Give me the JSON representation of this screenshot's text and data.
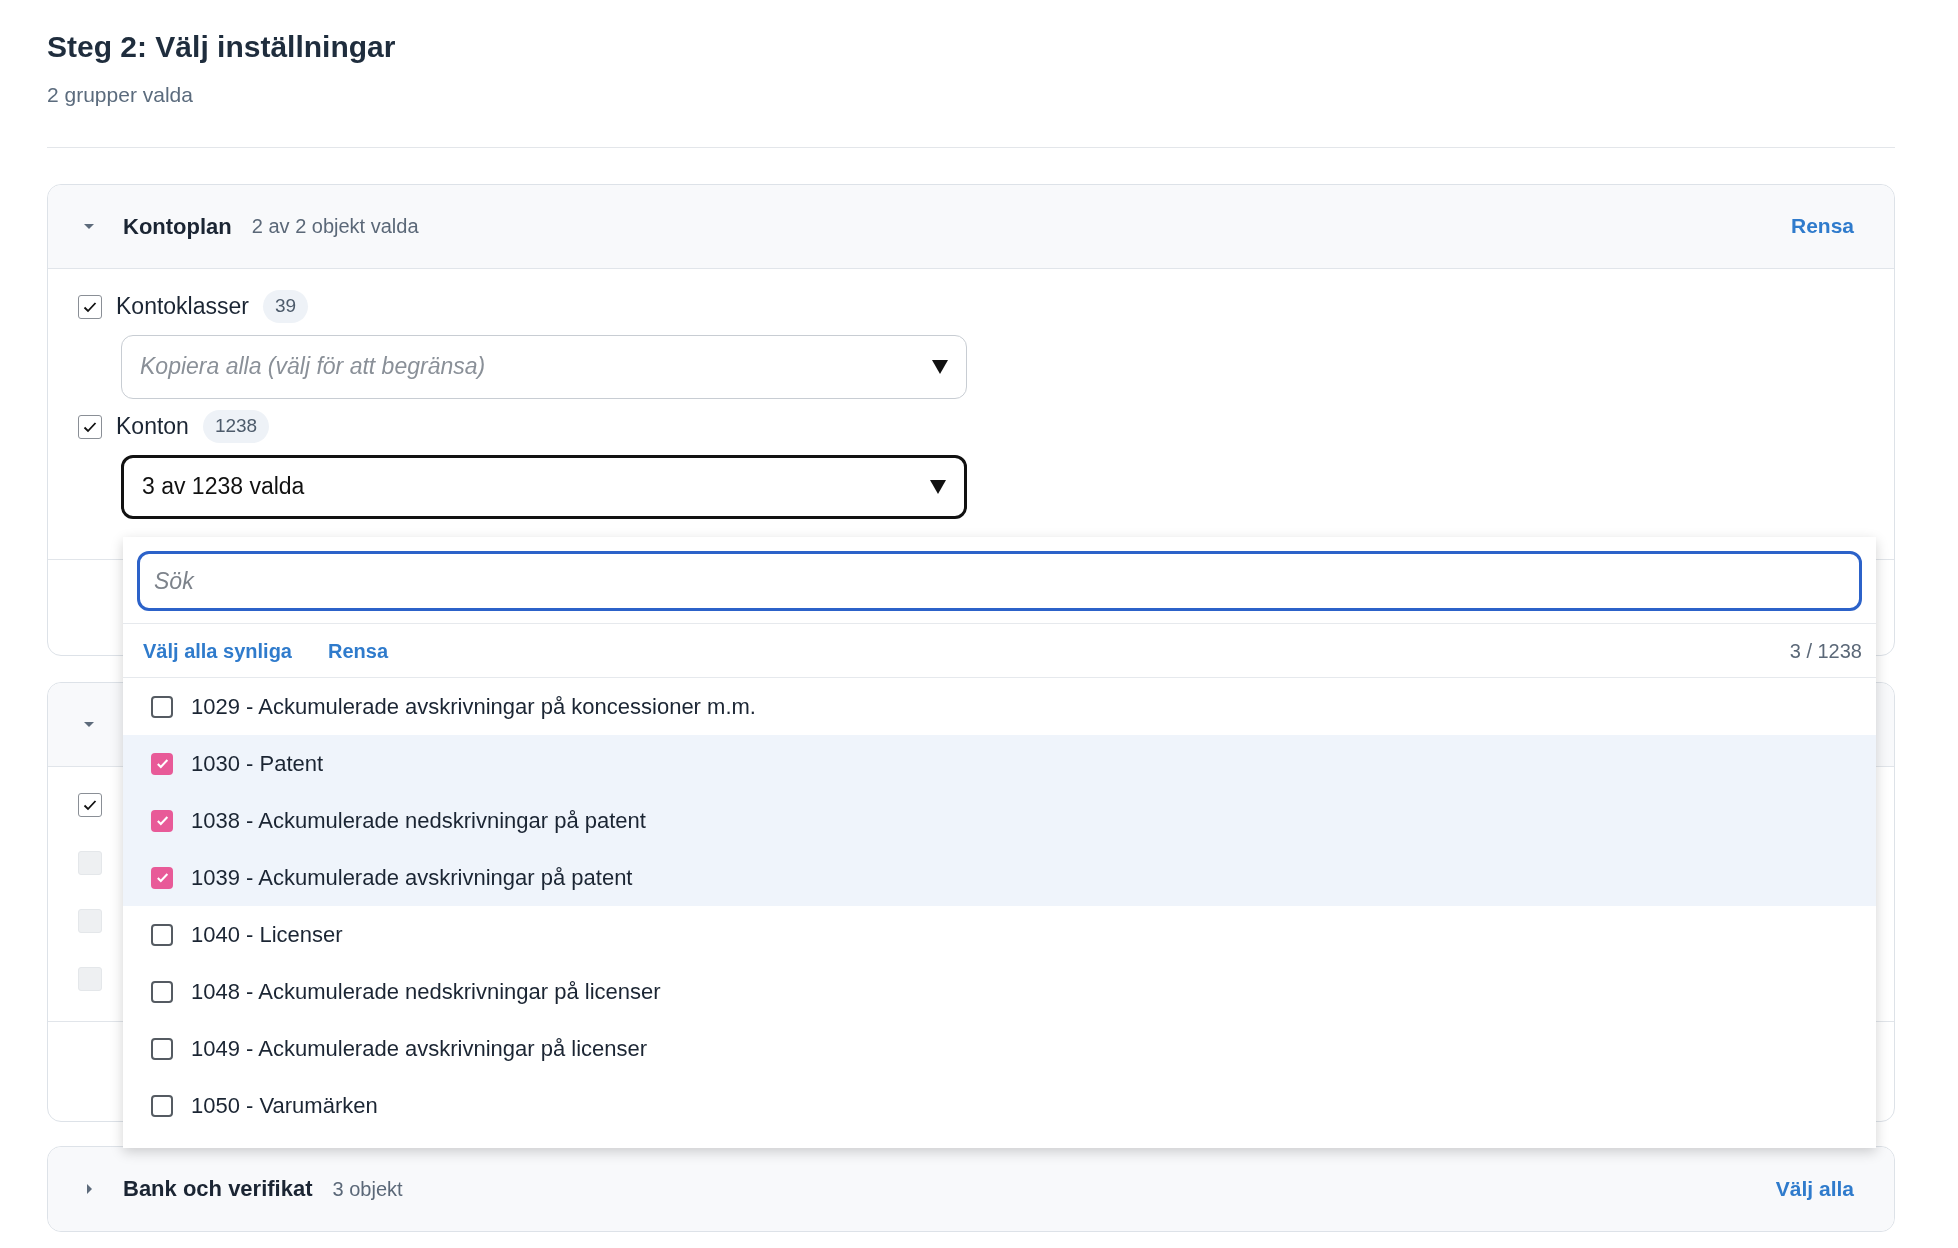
{
  "title": "Steg 2: Välj inställningar",
  "subtitle": "2 grupper valda",
  "groups": [
    {
      "name": "Kontoplan",
      "summary": "2 av 2 objekt valda",
      "action": "Rensa",
      "expanded": true,
      "items": [
        {
          "label": "Kontoklasser",
          "count": "39",
          "checked": true,
          "select": {
            "placeholder": "Kopiera alla (välj för att begränsa)",
            "open": false
          }
        },
        {
          "label": "Konton",
          "count": "1238",
          "checked": true,
          "select": {
            "value": "3 av 1238 valda",
            "open": true
          }
        }
      ]
    },
    {
      "expanded": true,
      "items": [
        {
          "checked": true,
          "disabled": false
        },
        {
          "checked": false,
          "disabled": true
        },
        {
          "checked": false,
          "disabled": true
        },
        {
          "checked": false,
          "disabled": true
        }
      ]
    },
    {
      "name": "Bank och verifikat",
      "summary": "3 objekt",
      "action": "Välj alla",
      "expanded": false
    }
  ],
  "dropdown": {
    "search": {
      "placeholder": "Sök"
    },
    "select_visible": "Välj alla synliga",
    "clear": "Rensa",
    "counter": "3 / 1238",
    "options": [
      {
        "label": "1029 - Ackumulerade avskrivningar på koncessioner m.m.",
        "checked": false
      },
      {
        "label": "1030 - Patent",
        "checked": true
      },
      {
        "label": "1038 - Ackumulerade nedskrivningar på patent",
        "checked": true
      },
      {
        "label": "1039 - Ackumulerade avskrivningar på patent",
        "checked": true
      },
      {
        "label": "1040 - Licenser",
        "checked": false
      },
      {
        "label": "1048 - Ackumulerade nedskrivningar på licenser",
        "checked": false
      },
      {
        "label": "1049 - Ackumulerade avskrivningar på licenser",
        "checked": false
      },
      {
        "label": "1050 - Varumärken",
        "checked": false
      }
    ]
  }
}
